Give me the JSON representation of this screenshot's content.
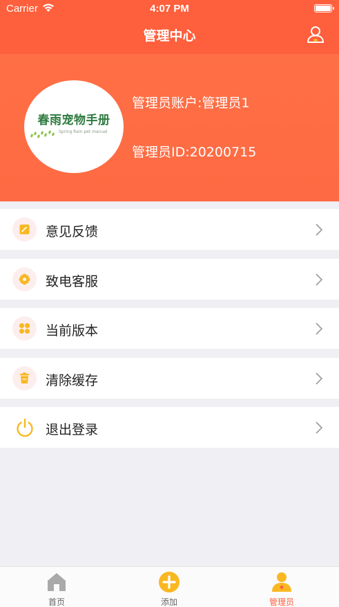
{
  "status": {
    "carrier": "Carrier",
    "time": "4:07 PM"
  },
  "nav": {
    "title": "管理中心",
    "user_icon": "user-profile-icon"
  },
  "profile": {
    "logo_title": "春雨宠物手册",
    "logo_subtitle": "Spring Rain pet manual",
    "account_text": "管理员账户:管理员1",
    "id_text": "管理员ID:20200715"
  },
  "menu": [
    {
      "label": "意见反馈",
      "icon": "feedback-note-icon"
    },
    {
      "label": "致电客服",
      "icon": "flower-gear-icon"
    },
    {
      "label": "当前版本",
      "icon": "clover-icon"
    },
    {
      "label": "清除缓存",
      "icon": "trash-icon"
    },
    {
      "label": "退出登录",
      "icon": "power-icon"
    }
  ],
  "tabs": [
    {
      "label": "首页",
      "icon": "home-icon"
    },
    {
      "label": "添加",
      "icon": "add-circle-icon"
    },
    {
      "label": "管理员",
      "icon": "admin-user-icon"
    }
  ],
  "colors": {
    "brand": "#fe5f3c",
    "accent_yellow": "#f9b822",
    "background": "#efeff4"
  }
}
